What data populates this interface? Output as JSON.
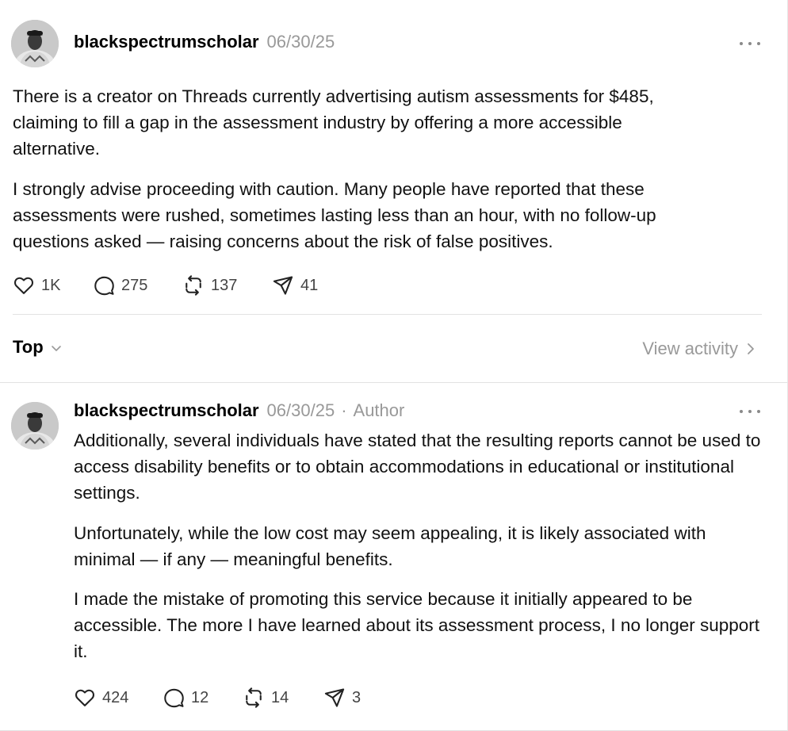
{
  "post": {
    "username": "blackspectrumscholar",
    "date": "06/30/25",
    "paragraphs": [
      "There is a creator on Threads currently advertising autism assessments for $485, claiming to fill a gap in the assessment industry by offering a more accessible alternative.",
      "I strongly advise proceeding with caution. Many people have reported that these assessments were rushed, sometimes lasting less than an hour, with no follow-up questions asked — raising concerns about the risk of false positives."
    ],
    "stats": {
      "likes": "1K",
      "replies": "275",
      "reposts": "137",
      "shares": "41"
    }
  },
  "sort": {
    "label": "Top",
    "view_activity": "View activity"
  },
  "reply": {
    "username": "blackspectrumscholar",
    "date": "06/30/25",
    "separator": "·",
    "author_tag": "Author",
    "paragraphs": [
      "Additionally, several individuals have stated that the resulting reports cannot be used to access disability benefits or to obtain accommodations in educational or institutional settings.",
      "Unfortunately, while the low cost may seem appealing, it is likely associated with minimal — if any — meaningful benefits.",
      "I made the mistake of promoting this service because it initially appeared to be accessible. The more I have learned about its assessment process, I no longer support it."
    ],
    "stats": {
      "likes": "424",
      "replies": "12",
      "reposts": "14",
      "shares": "3"
    }
  },
  "icons": {
    "like": "heart-icon",
    "reply": "speech-bubble-icon",
    "repost": "repost-icon",
    "share": "send-icon",
    "more": "more-dots-icon",
    "sort": "chevron-down-icon",
    "activity": "chevron-right-icon"
  },
  "colors": {
    "text": "#000000",
    "muted": "#999999",
    "divider": "#e2e2e2"
  }
}
